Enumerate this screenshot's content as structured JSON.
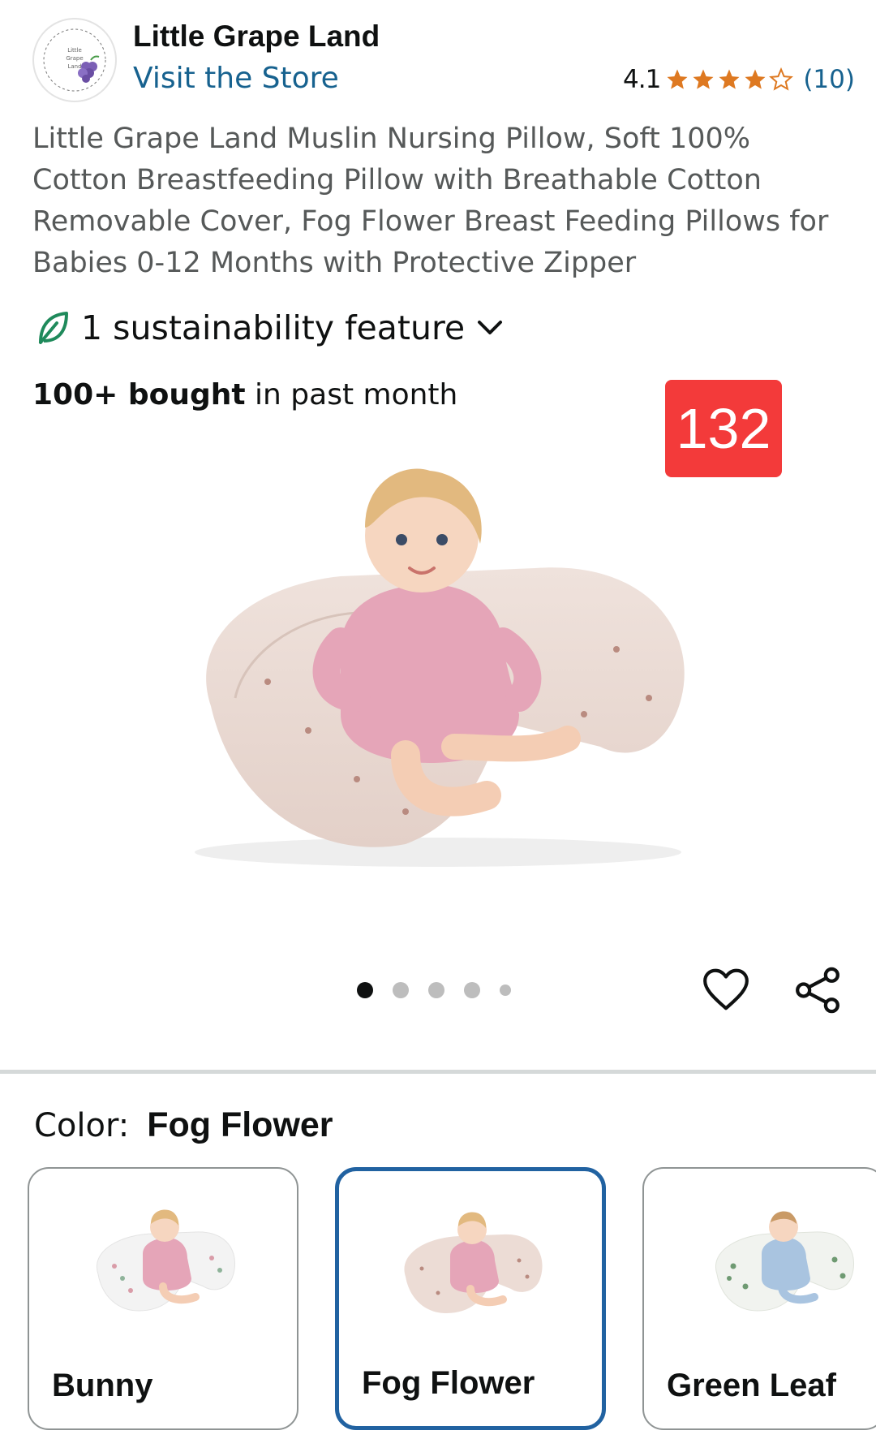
{
  "header": {
    "brand_name": "Little Grape Land",
    "visit_store": "Visit the Store",
    "rating_value": "4.1",
    "rating_stars": 4.1,
    "review_count": "(10)",
    "logo_icon": "grape-logo-icon",
    "accent_color": "#17628f",
    "star_color": "#de7921"
  },
  "product": {
    "title": "Little Grape Land Muslin Nursing Pillow, Soft 100% Cotton Breastfeeding Pillow with Breathable Cotton Removable Cover, Fog Flower Breast Feeding Pillows for Babies 0-12 Months with Protective Zipper",
    "sustainability": "1 sustainability feature",
    "bought_bold": "100+ bought",
    "bought_rest": " in past month",
    "count_badge": "132",
    "badge_color": "#f33a3a",
    "image_icon": "nursing-pillow-baby-image",
    "total_images": 5,
    "active_image": 1
  },
  "actions": {
    "favorite_icon": "heart-icon",
    "share_icon": "share-icon"
  },
  "color": {
    "label": "Color:",
    "selected": "Fog Flower",
    "options": [
      {
        "name": "Bunny",
        "selected": false
      },
      {
        "name": "Fog Flower",
        "selected": true
      },
      {
        "name": "Green Leaf",
        "selected": false
      }
    ],
    "selected_border_color": "#2162a1"
  }
}
